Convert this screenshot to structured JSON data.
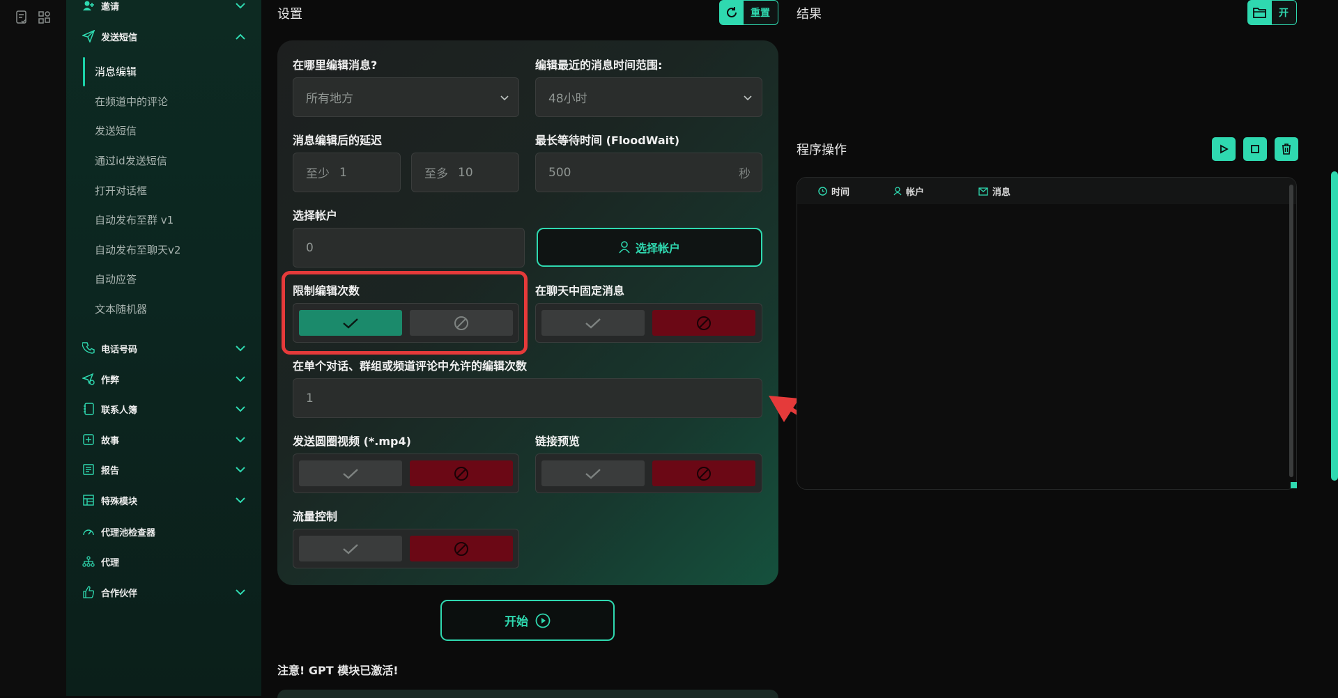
{
  "sidebar": {
    "groups": [
      {
        "label": "邀请"
      },
      {
        "label": "发送短信"
      },
      {
        "label": "电话号码"
      },
      {
        "label": "作弊"
      },
      {
        "label": "联系人簿"
      },
      {
        "label": "故事"
      },
      {
        "label": "报告"
      },
      {
        "label": "特殊模块"
      },
      {
        "label": "代理池检查器"
      },
      {
        "label": "代理"
      },
      {
        "label": "合作伙伴"
      }
    ],
    "sub_items": [
      {
        "label": "消息编辑"
      },
      {
        "label": "在频道中的评论"
      },
      {
        "label": "发送短信"
      },
      {
        "label": "通过id发送短信"
      },
      {
        "label": "打开对话框"
      },
      {
        "label": "自动发布至群 v1"
      },
      {
        "label": "自动发布至聊天v2"
      },
      {
        "label": "自动应答"
      },
      {
        "label": "文本随机器"
      }
    ]
  },
  "settings": {
    "title": "设置",
    "reset_label": "重置",
    "where_label": "在哪里编辑消息?",
    "where_value": "所有地方",
    "range_label": "编辑最近的消息时间范围:",
    "range_value": "48小时",
    "delay_label": "消息编辑后的延迟",
    "delay_min_prefix": "至少",
    "delay_min_value": "1",
    "delay_max_prefix": "至多",
    "delay_max_value": "10",
    "floodwait_label": "最长等待时间 (FloodWait)",
    "floodwait_value": "500",
    "floodwait_unit": "秒",
    "account_label": "选择帐户",
    "account_value": "0",
    "select_account_button": "选择帐户",
    "limit_edits_label": "限制编辑次数",
    "pin_label": "在聊天中固定消息",
    "allowed_edits_label": "在单个对话、群组或频道评论中允许的编辑次数",
    "allowed_edits_value": "1",
    "round_video_label": "发送圆圈视频 (*.mp4)",
    "link_preview_label": "链接预览",
    "flow_control_label": "流量控制",
    "start_button": "开始",
    "gpt_notice": "注意! GPT 模块已激活!"
  },
  "results": {
    "title": "结果",
    "open_label": "开",
    "ops_title": "程序操作",
    "log_columns": [
      "时间",
      "帐户",
      "消息"
    ]
  },
  "colors": {
    "accent": "#2fd9b0",
    "toggle_on": "#1b8a6b",
    "toggle_off_red": "#6b0815",
    "highlight": "#e53a3a"
  }
}
